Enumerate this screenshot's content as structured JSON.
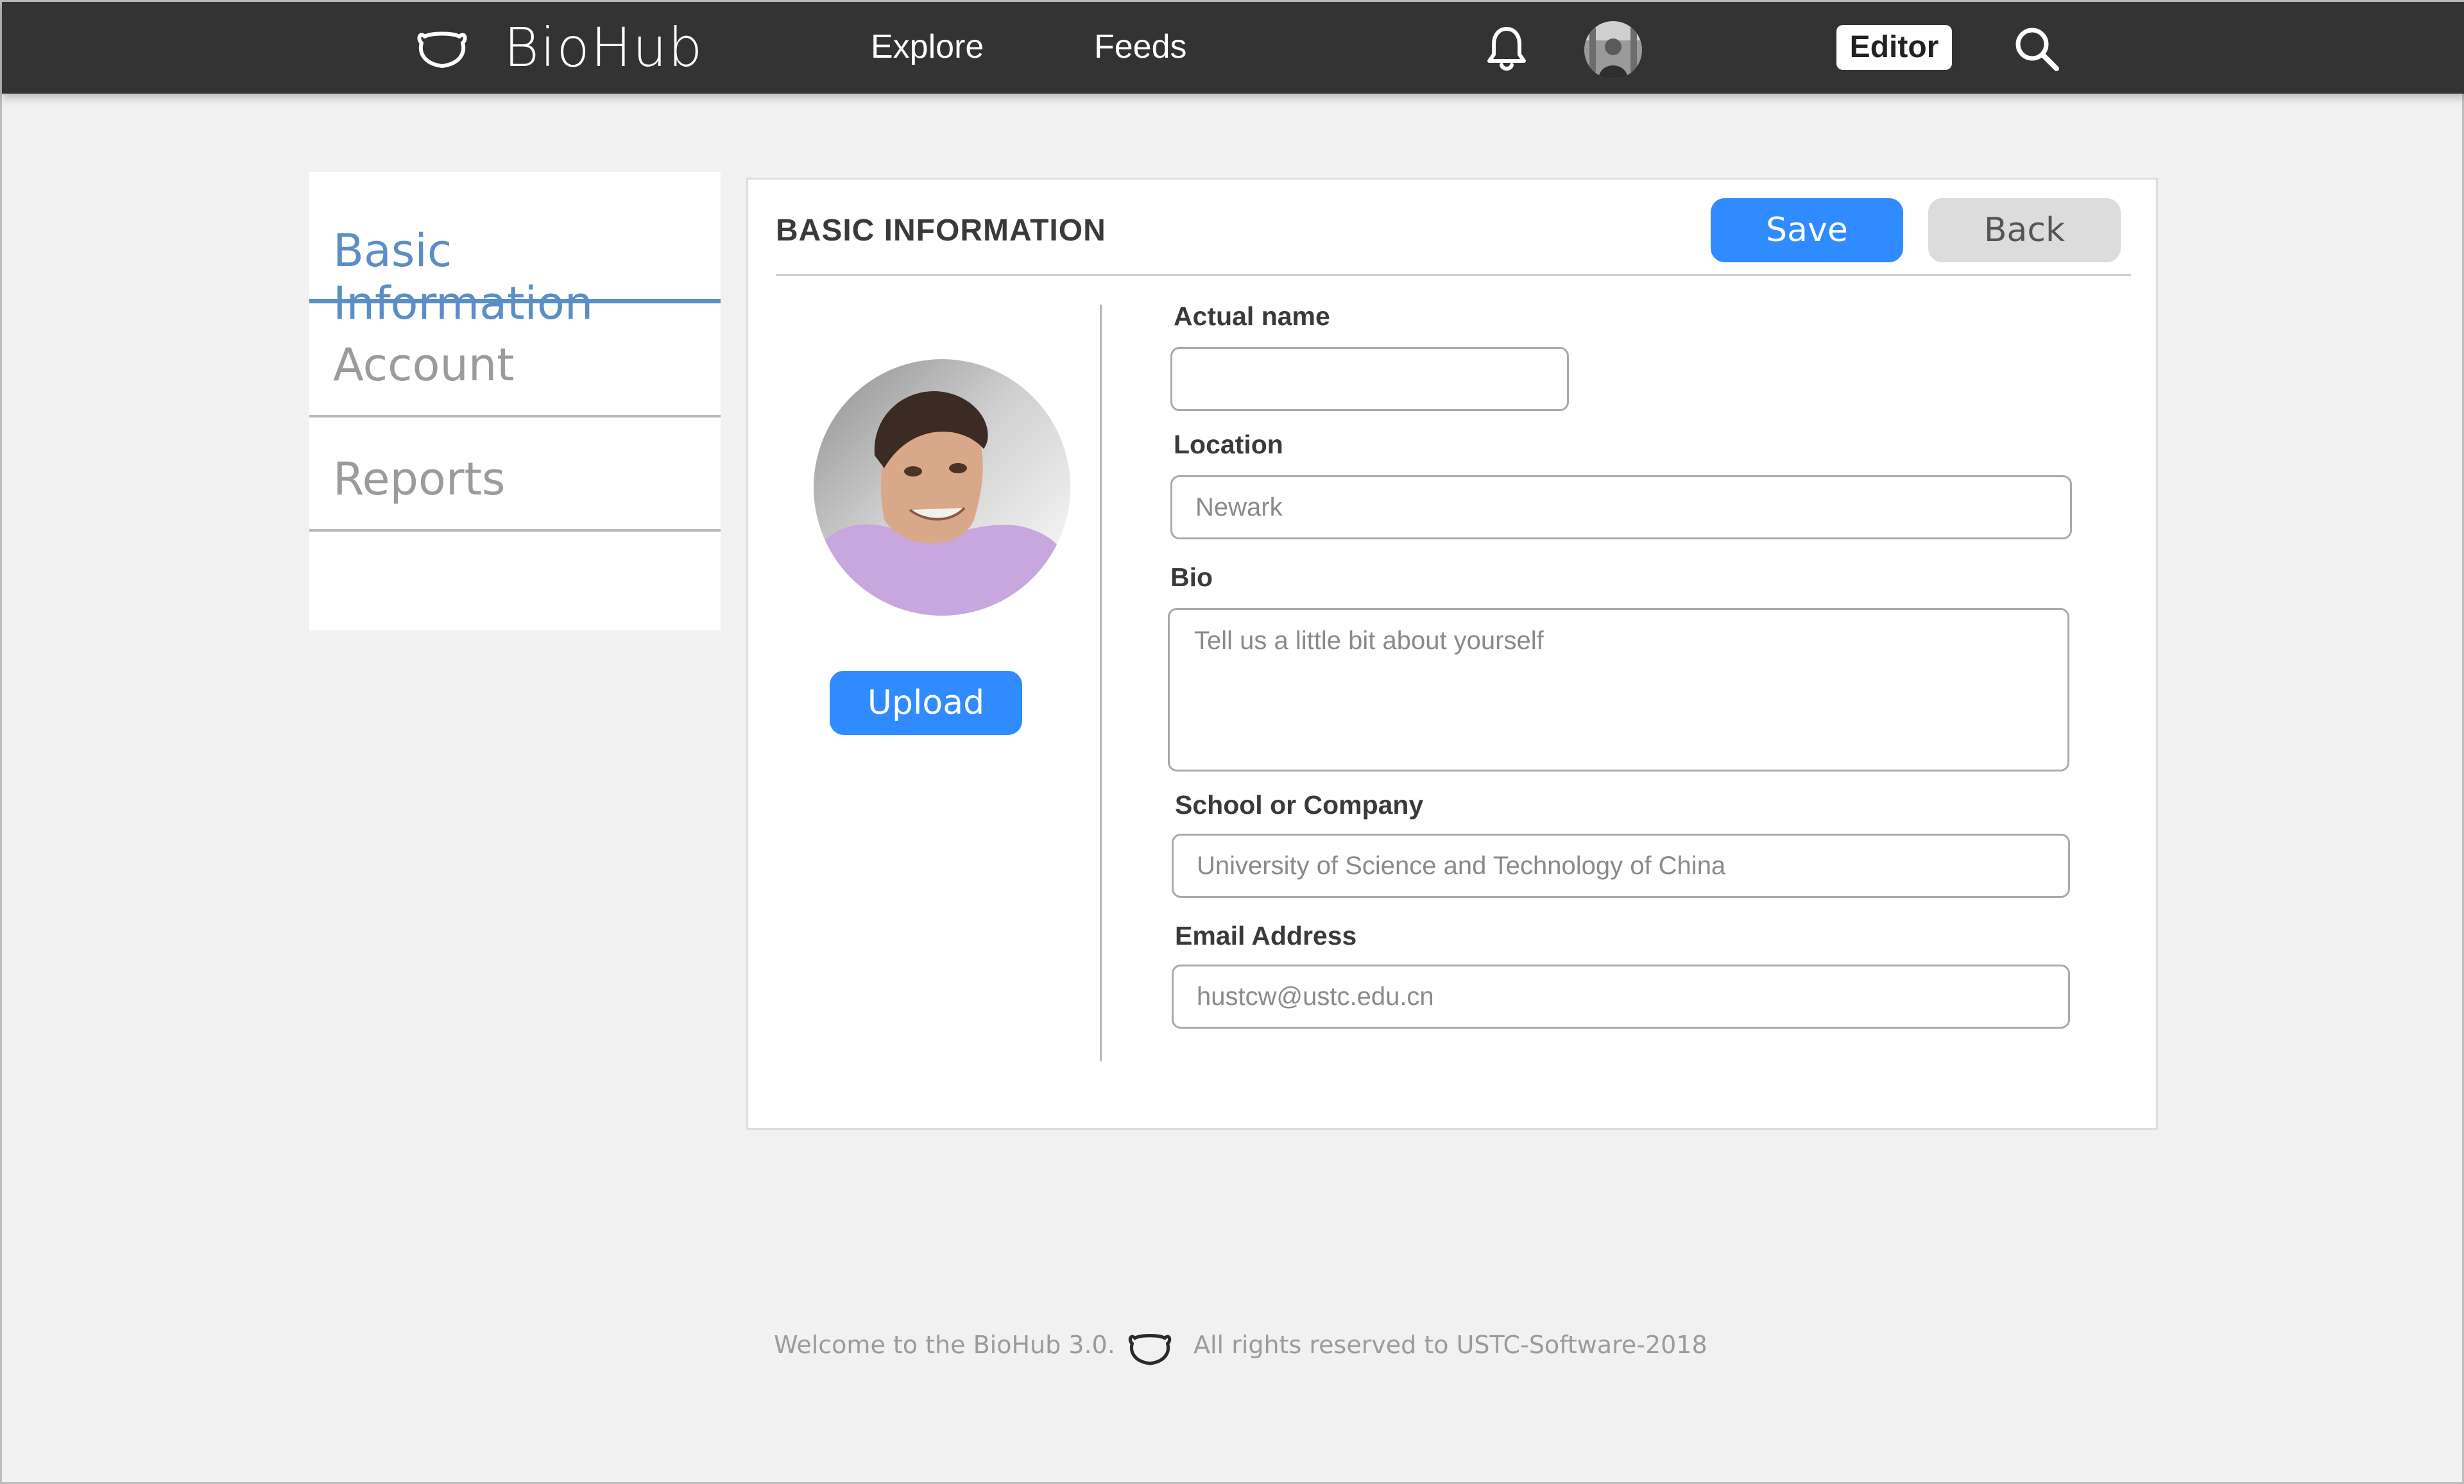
{
  "header": {
    "brand": "BioHub",
    "nav": {
      "explore": "Explore",
      "feeds": "Feeds"
    },
    "editor_badge": "Editor",
    "icons": {
      "logo": "bear-face-icon",
      "notifications": "bell-icon",
      "search": "search-icon"
    }
  },
  "sidebar": {
    "items": [
      {
        "label": "Basic Information",
        "active": true
      },
      {
        "label": "Account",
        "active": false
      },
      {
        "label": "Reports",
        "active": false
      }
    ]
  },
  "panel": {
    "title": "BASIC INFORMATION",
    "save_label": "Save",
    "back_label": "Back",
    "upload_label": "Upload",
    "fields": {
      "actual_name": {
        "label": "Actual name",
        "value": "",
        "placeholder": ""
      },
      "location": {
        "label": "Location",
        "value": "",
        "placeholder": "Newark"
      },
      "bio": {
        "label": "Bio",
        "value": "",
        "placeholder": "Tell us a little bit about yourself"
      },
      "school": {
        "label": "School or Company",
        "value": "",
        "placeholder": "University of Science and Technology of China"
      },
      "email": {
        "label": "Email Address",
        "value": "",
        "placeholder": "hustcw@ustc.edu.cn"
      }
    }
  },
  "footer": {
    "welcome": "Welcome to the BioHub 3.0.",
    "rights": "All rights reserved to USTC-Software-2018"
  },
  "colors": {
    "topbar": "#333333",
    "accent_blue": "#2f8bff",
    "active_tab": "#5b8ec6",
    "page_bg": "#f1f1f1"
  }
}
